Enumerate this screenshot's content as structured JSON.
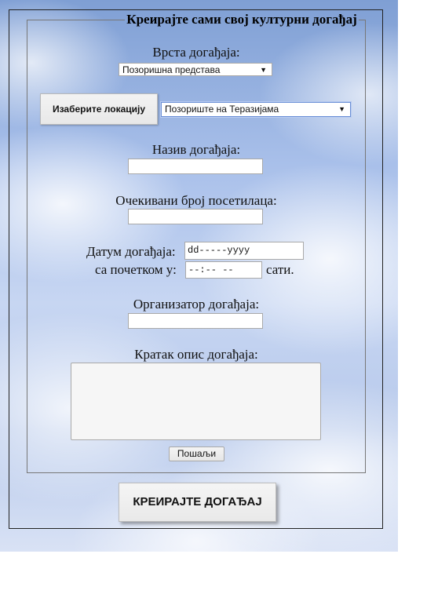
{
  "form": {
    "legend": "Креирајте сами свој културни догађај",
    "event_type": {
      "label": "Врста догађаја:",
      "selected": "Позоришна представа"
    },
    "location": {
      "button_label": "Изаберите локацију",
      "selected": "Позориште на Теразијама"
    },
    "event_name": {
      "label": "Назив догађаја:",
      "value": ""
    },
    "expected_visitors": {
      "label": "Очекивани број посетилаца:",
      "value": ""
    },
    "date": {
      "label": "Датум догађаја:",
      "placeholder": "dd-----yyyy"
    },
    "start_time": {
      "label": "са почетком у:",
      "placeholder": "--:-- --",
      "suffix": "сати."
    },
    "organizer": {
      "label": "Организатор догађаја:",
      "value": ""
    },
    "description": {
      "label": "Кратак опис догађаја:",
      "value": ""
    },
    "submit_label": "Пошаљи"
  },
  "create_button_label": "КРЕИРАЈТЕ ДОГАЂАЈ",
  "icons": {
    "dropdown": "chevron-down-icon"
  },
  "colors": {
    "sky_top": "#7f9fd4",
    "sky_bottom": "#d9e2f5",
    "focus_border": "#6a8fd6"
  }
}
